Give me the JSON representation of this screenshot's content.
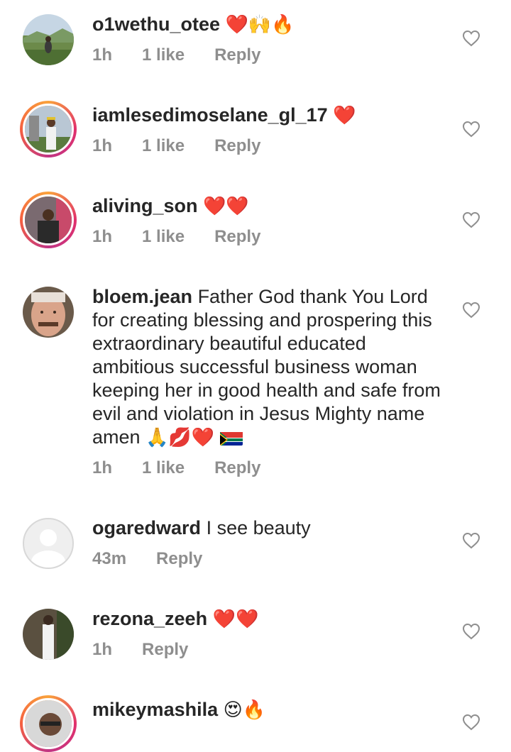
{
  "comments": [
    {
      "username": "o1wethu_otee",
      "text": "",
      "emojis": "❤️🙌🔥",
      "time": "1h",
      "likes": "1 like",
      "reply": "Reply",
      "avatar": "landscape-photo",
      "story_ring": false
    },
    {
      "username": "iamlesedimoselane_gl_17",
      "text": "",
      "emojis": "❤️",
      "time": "1h",
      "likes": "1 like",
      "reply": "Reply",
      "avatar": "person-photo",
      "story_ring": true
    },
    {
      "username": "aliving_son",
      "text": "",
      "emojis": "❤️❤️",
      "time": "1h",
      "likes": "1 like",
      "reply": "Reply",
      "avatar": "person-photo",
      "story_ring": true
    },
    {
      "username": "bloem.jean",
      "text": "Father God thank You Lord for creating blessing and prospering this extraordinary beautiful educated ambitious successful business woman keeping her in good health and safe from evil and violation in Jesus Mighty name amen",
      "emojis": "🙏💋❤️",
      "time": "1h",
      "likes": "1 like",
      "reply": "Reply",
      "avatar": "face-photo",
      "story_ring": false
    },
    {
      "username": "ogaredward",
      "text": "I see beauty",
      "emojis": "",
      "time": "43m",
      "likes": "",
      "reply": "Reply",
      "avatar": "default-avatar",
      "story_ring": false
    },
    {
      "username": "rezona_zeeh",
      "text": "",
      "emojis": "❤️❤️",
      "time": "1h",
      "likes": "",
      "reply": "Reply",
      "avatar": "person-photo",
      "story_ring": false
    },
    {
      "username": "mikeymashila",
      "text": "",
      "emojis": "😍🔥",
      "time": "",
      "likes": "",
      "reply": "",
      "avatar": "person-photo",
      "story_ring": true
    }
  ],
  "colors": {
    "username": "#262626",
    "meta": "#8e8e8e",
    "heart_outline": "#8e8e8e"
  },
  "icons": {
    "like": "heart-outline-icon",
    "flag": "south-africa-flag-icon"
  }
}
